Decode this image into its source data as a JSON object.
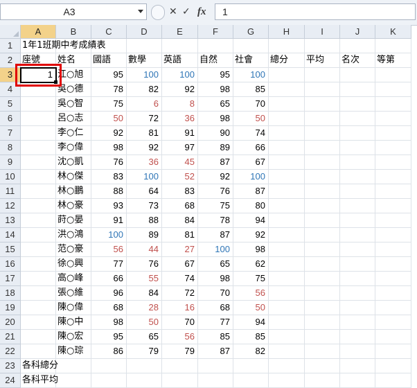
{
  "formula_bar": {
    "name_box": "A3",
    "formula": "1",
    "cancel_icon": "close-icon",
    "enter_icon": "check-icon",
    "function_label": "fx"
  },
  "columns": [
    "A",
    "B",
    "C",
    "D",
    "E",
    "F",
    "G",
    "H",
    "I",
    "J",
    "K"
  ],
  "rows": [
    "1",
    "2",
    "3",
    "4",
    "5",
    "6",
    "7",
    "8",
    "9",
    "10",
    "11",
    "12",
    "13",
    "14",
    "15",
    "16",
    "17",
    "18",
    "19",
    "20",
    "21",
    "22",
    "23",
    "24"
  ],
  "sheet": {
    "title": "1年1班期中考成績表",
    "headers": [
      "座號",
      "姓名",
      "國語",
      "數學",
      "英語",
      "自然",
      "社會",
      "總分",
      "平均",
      "名次",
      "等第"
    ],
    "students": [
      {
        "seat": "1",
        "name": "江○旭",
        "scores": [
          "95",
          "100",
          "100",
          "95",
          "100"
        ]
      },
      {
        "seat": "",
        "name": "吳○德",
        "scores": [
          "78",
          "82",
          "92",
          "98",
          "85"
        ]
      },
      {
        "seat": "",
        "name": "吳○智",
        "scores": [
          "75",
          "6",
          "8",
          "65",
          "70"
        ]
      },
      {
        "seat": "",
        "name": "呂○志",
        "scores": [
          "50",
          "72",
          "36",
          "98",
          "50"
        ]
      },
      {
        "seat": "",
        "name": "李○仁",
        "scores": [
          "92",
          "81",
          "91",
          "90",
          "74"
        ]
      },
      {
        "seat": "",
        "name": "李○偉",
        "scores": [
          "98",
          "92",
          "97",
          "89",
          "66"
        ]
      },
      {
        "seat": "",
        "name": "沈○凱",
        "scores": [
          "76",
          "36",
          "45",
          "87",
          "67"
        ]
      },
      {
        "seat": "",
        "name": "林○傑",
        "scores": [
          "83",
          "100",
          "52",
          "92",
          "100"
        ]
      },
      {
        "seat": "",
        "name": "林○鵬",
        "scores": [
          "88",
          "64",
          "83",
          "76",
          "87"
        ]
      },
      {
        "seat": "",
        "name": "林○豪",
        "scores": [
          "93",
          "73",
          "68",
          "75",
          "80"
        ]
      },
      {
        "seat": "",
        "name": "莳○晏",
        "scores": [
          "91",
          "88",
          "84",
          "78",
          "94"
        ]
      },
      {
        "seat": "",
        "name": "洪○鴻",
        "scores": [
          "100",
          "89",
          "81",
          "87",
          "92"
        ]
      },
      {
        "seat": "",
        "name": "范○豪",
        "scores": [
          "56",
          "44",
          "27",
          "100",
          "98"
        ]
      },
      {
        "seat": "",
        "name": "徐○興",
        "scores": [
          "77",
          "76",
          "67",
          "65",
          "62"
        ]
      },
      {
        "seat": "",
        "name": "高○峰",
        "scores": [
          "66",
          "55",
          "74",
          "98",
          "75"
        ]
      },
      {
        "seat": "",
        "name": "張○維",
        "scores": [
          "96",
          "84",
          "72",
          "70",
          "56"
        ]
      },
      {
        "seat": "",
        "name": "陳○偉",
        "scores": [
          "68",
          "28",
          "16",
          "68",
          "50"
        ]
      },
      {
        "seat": "",
        "name": "陳○中",
        "scores": [
          "98",
          "50",
          "70",
          "77",
          "94"
        ]
      },
      {
        "seat": "",
        "name": "陳○宏",
        "scores": [
          "95",
          "65",
          "56",
          "85",
          "85"
        ]
      },
      {
        "seat": "",
        "name": "陳○琮",
        "scores": [
          "86",
          "79",
          "79",
          "87",
          "82"
        ]
      }
    ],
    "footer_total": "各科總分",
    "footer_average": "各科平均"
  },
  "styles": {
    "score_100_color": "#2e75b6",
    "score_failing_color": "#c0504d",
    "selected_header_color": "#f3d28a",
    "highlight_box_color": "#e00000"
  }
}
